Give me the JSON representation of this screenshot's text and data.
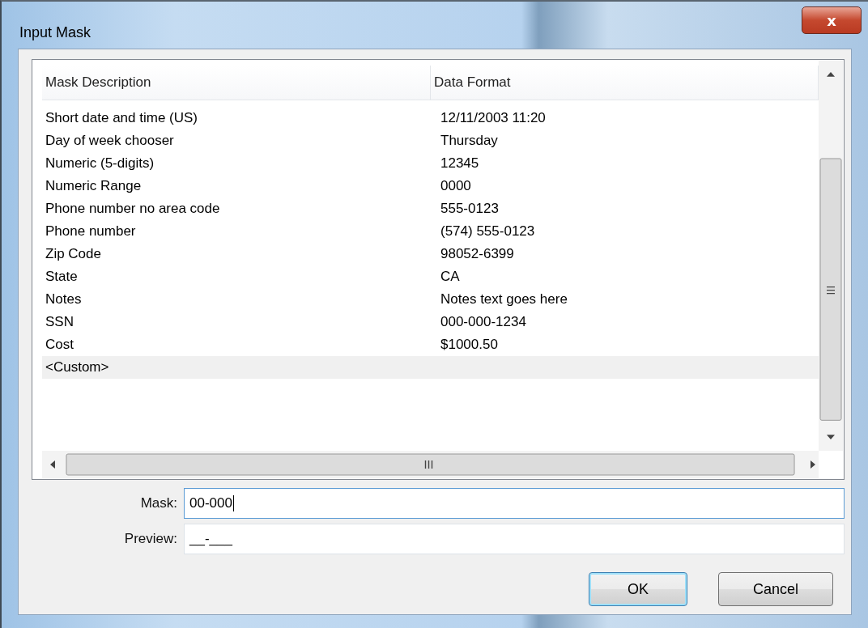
{
  "window": {
    "title": "Input Mask",
    "close": "x"
  },
  "list": {
    "columns": [
      "Mask Description",
      "Data Format"
    ],
    "rows": [
      {
        "description": "Short date and time (US)",
        "format": "12/11/2003 11:20",
        "selected": false
      },
      {
        "description": "Day of week chooser",
        "format": "Thursday",
        "selected": false
      },
      {
        "description": "Numeric (5-digits)",
        "format": "12345",
        "selected": false
      },
      {
        "description": "Numeric Range",
        "format": "0000",
        "selected": false
      },
      {
        "description": "Phone number no area code",
        "format": "555-0123",
        "selected": false
      },
      {
        "description": "Phone number",
        "format": "(574) 555-0123",
        "selected": false
      },
      {
        "description": "Zip Code",
        "format": "98052-6399",
        "selected": false
      },
      {
        "description": "State",
        "format": "CA",
        "selected": false
      },
      {
        "description": "Notes",
        "format": "Notes text goes here",
        "selected": false
      },
      {
        "description": "SSN",
        "format": "000-000-1234",
        "selected": false
      },
      {
        "description": "Cost",
        "format": "$1000.50",
        "selected": false
      },
      {
        "description": "<Custom>",
        "format": "",
        "selected": true
      }
    ]
  },
  "fields": [
    {
      "label": "Mask:",
      "value": "00-000",
      "focused": true
    },
    {
      "label": "Preview:",
      "value": "__-___",
      "focused": false
    }
  ],
  "buttons": [
    {
      "label": "OK",
      "default": true
    },
    {
      "label": "Cancel",
      "default": false
    }
  ]
}
